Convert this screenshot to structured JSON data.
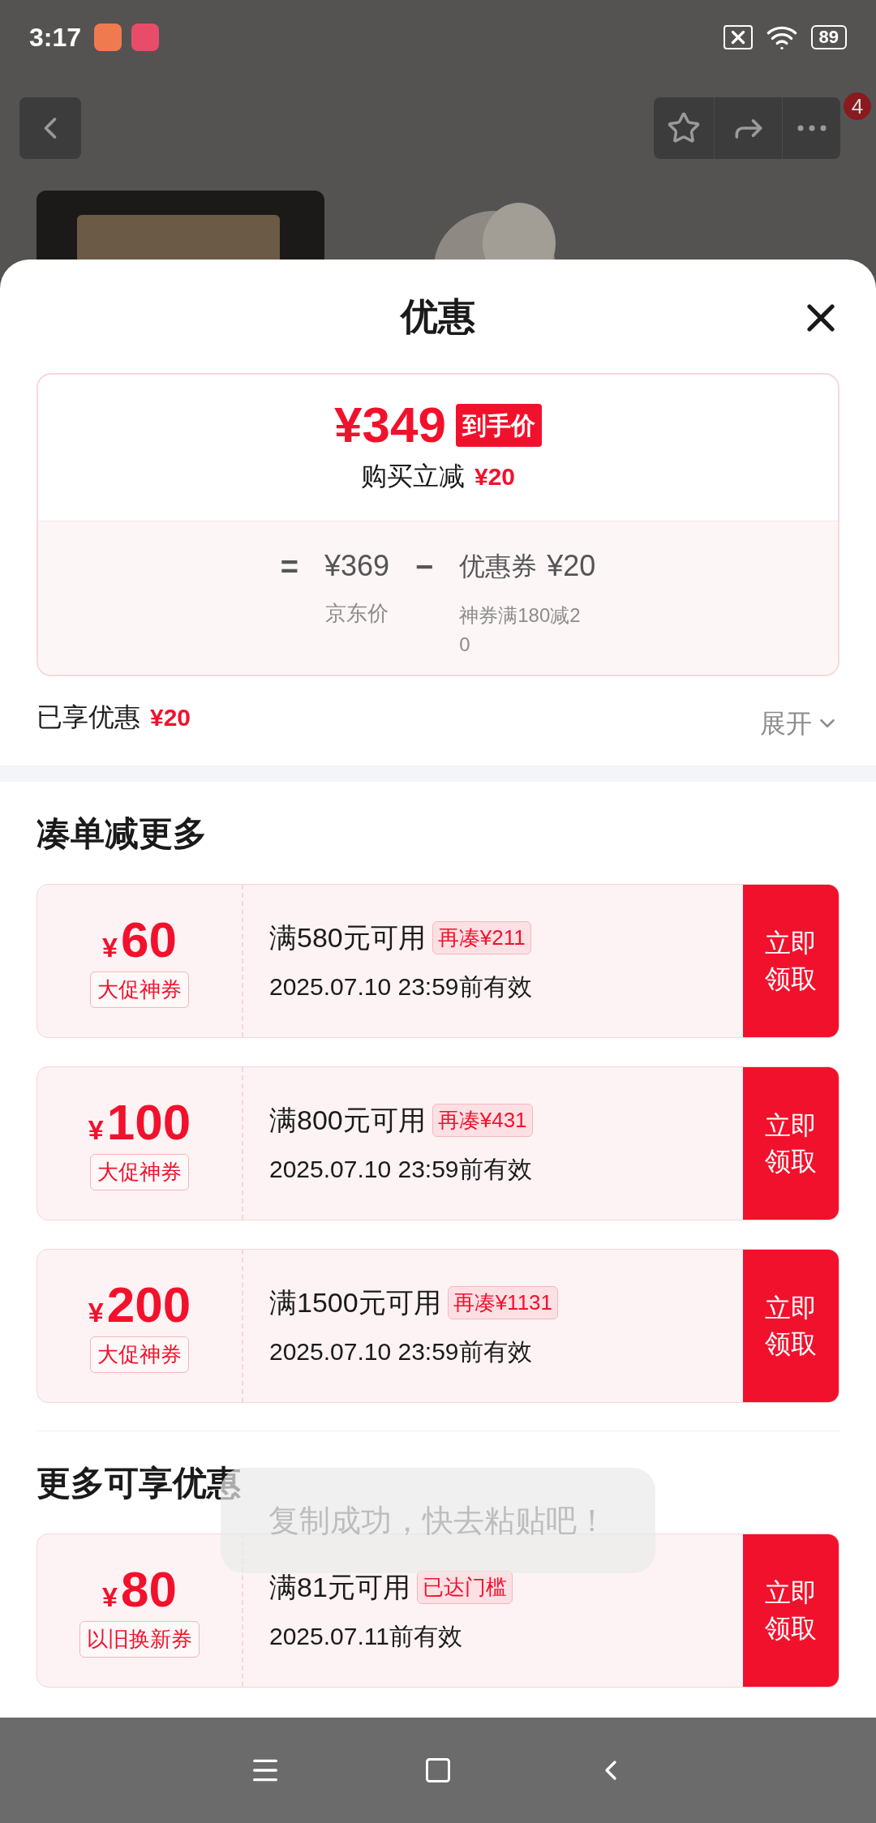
{
  "status_bar": {
    "time": "3:17",
    "battery": "89"
  },
  "header": {
    "cart_badge": "4"
  },
  "sheet": {
    "title": "优惠",
    "price_card": {
      "final_price": "¥349",
      "final_tag": "到手价",
      "discount_label": "购买立减",
      "discount_amount": "¥20",
      "equals": "=",
      "base_price": "¥369",
      "base_label": "京东价",
      "minus": "−",
      "coupon_label": "优惠券",
      "coupon_amount": "¥20",
      "coupon_note": "神券满180减20"
    },
    "enjoyed": {
      "label": "已享优惠",
      "amount": "¥20",
      "expand": "展开",
      "expanded": false
    },
    "sections": [
      {
        "title": "凑单减更多",
        "coupons": [
          {
            "currency": "¥",
            "amount": "60",
            "type": "大促神券",
            "condition": "满580元可用",
            "tag": "再凑¥211",
            "validity": "2025.07.10 23:59前有效",
            "action": "立即领取"
          },
          {
            "currency": "¥",
            "amount": "100",
            "type": "大促神券",
            "condition": "满800元可用",
            "tag": "再凑¥431",
            "validity": "2025.07.10 23:59前有效",
            "action": "立即领取"
          },
          {
            "currency": "¥",
            "amount": "200",
            "type": "大促神券",
            "condition": "满1500元可用",
            "tag": "再凑¥1131",
            "validity": "2025.07.10 23:59前有效",
            "action": "立即领取"
          }
        ]
      },
      {
        "title": "更多可享优惠",
        "coupons": [
          {
            "currency": "¥",
            "amount": "80",
            "type": "以旧换新券",
            "condition": "满81元可用",
            "tag": "已达门槛",
            "validity": "2025.07.11前有效",
            "action": "立即领取"
          }
        ]
      }
    ]
  },
  "toast": {
    "text": "复制成功，快去粘贴吧！"
  }
}
